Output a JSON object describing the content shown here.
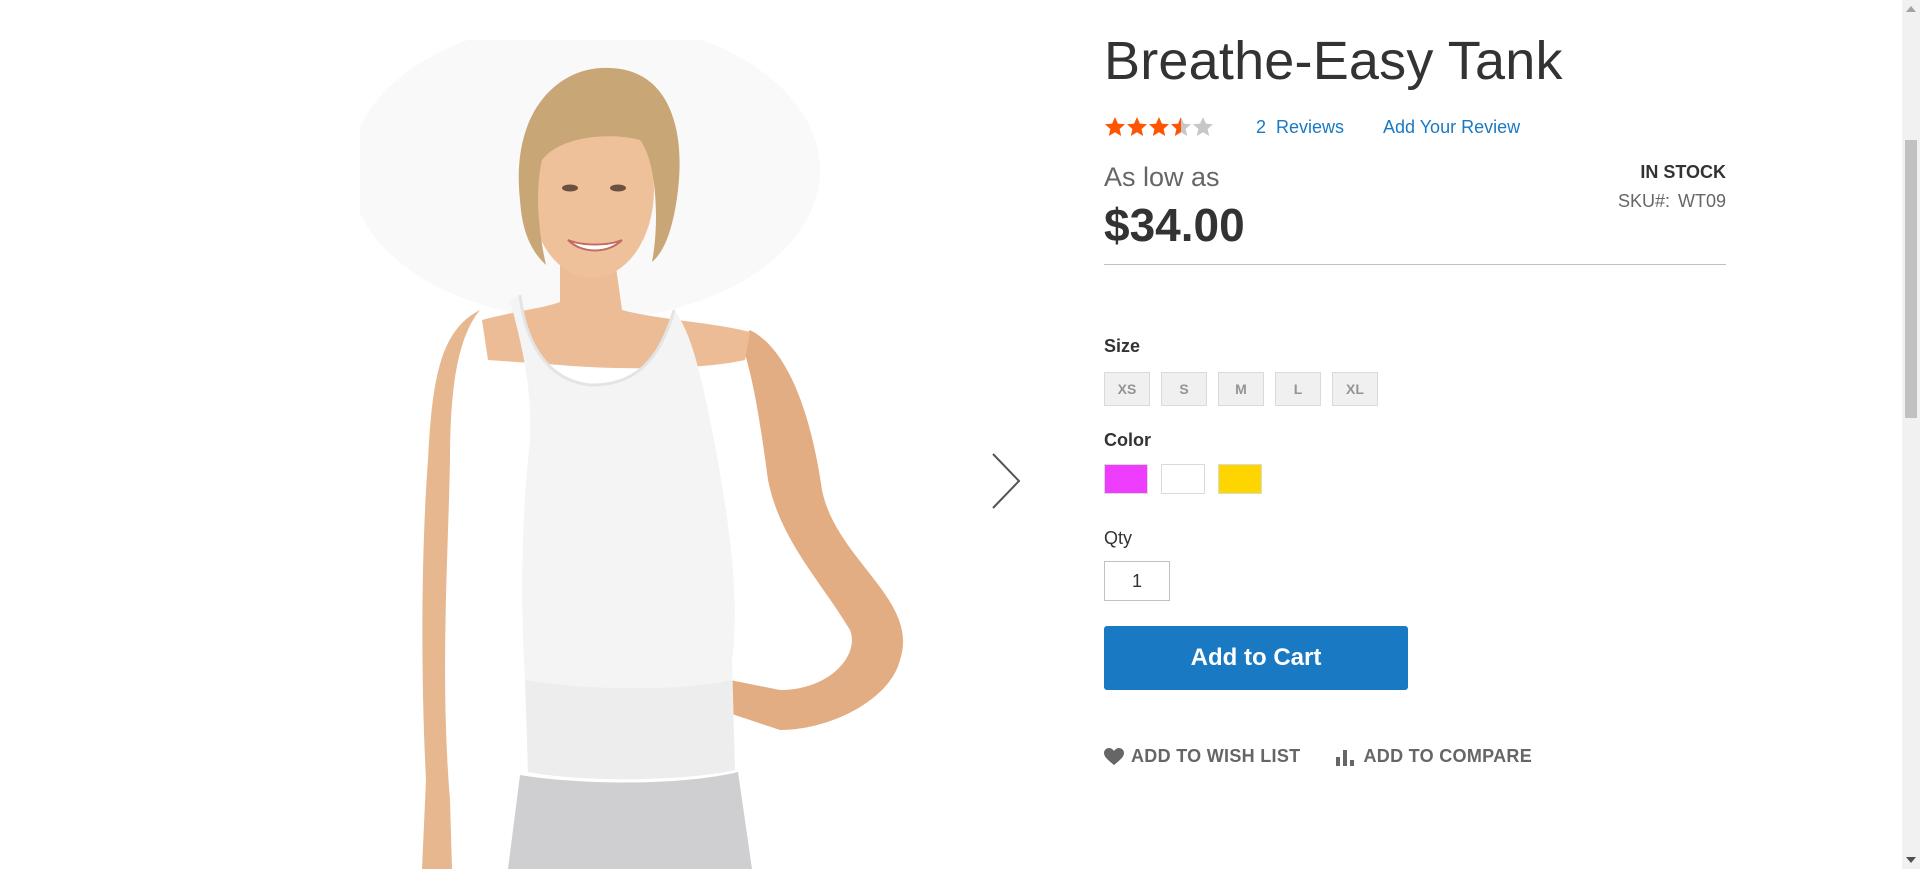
{
  "product": {
    "name": "Breathe-Easy Tank",
    "rating_percent": 70,
    "reviews_count": "2",
    "reviews_label": "Reviews",
    "add_review_label": "Add Your Review",
    "price_label": "As low as",
    "price": "$34.00",
    "stock_status": "IN STOCK",
    "sku_label": "SKU#:",
    "sku_value": "WT09"
  },
  "options": {
    "size_label": "Size",
    "sizes": [
      "XS",
      "S",
      "M",
      "L",
      "XL"
    ],
    "color_label": "Color",
    "colors": [
      "#ef3dff",
      "#ffffff",
      "#ffd500"
    ]
  },
  "qty": {
    "label": "Qty",
    "value": "1"
  },
  "actions": {
    "add_to_cart": "Add to Cart",
    "wishlist": "Add to Wish List",
    "compare": "Add to Compare"
  },
  "colors": {
    "accent": "#1979c3",
    "star_filled": "#ff5501",
    "star_empty": "#c7c7c7"
  },
  "icons": {
    "gallery_next": "chevron-right-icon",
    "wishlist": "heart-icon",
    "compare": "bar-chart-icon"
  }
}
